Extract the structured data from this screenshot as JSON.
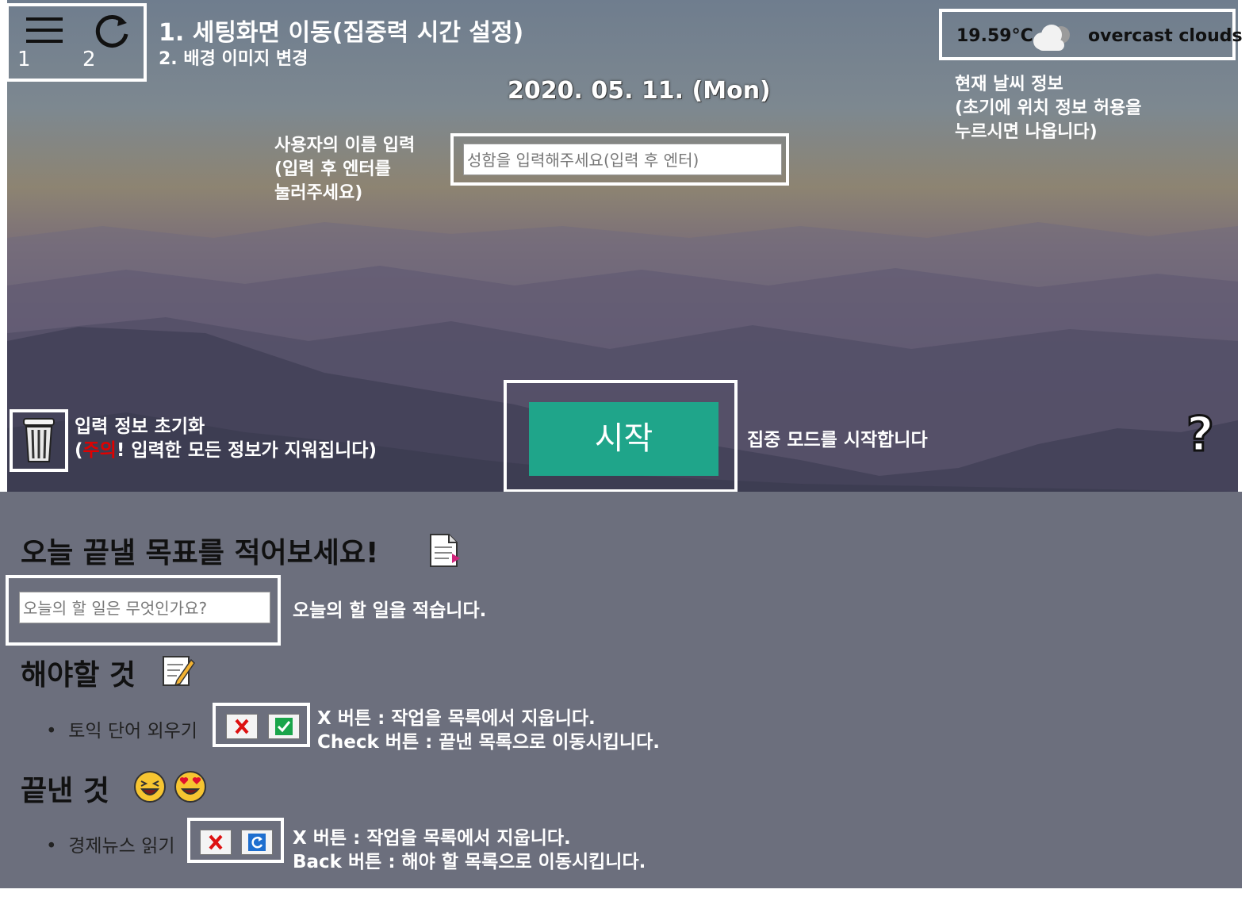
{
  "header": {
    "menu_number": "1",
    "refresh_number": "2",
    "note_line1": "1. 세팅화면 이동(집중력 시간 설정)",
    "note_line2": "2. 배경 이미지 변경"
  },
  "weather": {
    "temp": "19.59°C",
    "icon": "cloud-icon",
    "desc": "overcast clouds",
    "note_line1": "현재 날씨 정보",
    "note_line2": "(초기에 위치 정보 허용을",
    "note_line3": "누르시면 나옵니다)"
  },
  "date": "2020. 05. 11. (Mon)",
  "name_input": {
    "placeholder": "성함을 입력해주세요(입력 후 엔터)",
    "note_line1": "사용자의 이름 입력",
    "note_line2": "(입력 후 엔터를",
    "note_line3": "눌러주세요)"
  },
  "reset": {
    "icon": "trash-icon",
    "note_line1": "입력 정보 초기화",
    "note_paren_open": "(",
    "note_warning": "주의",
    "note_rest": "! 입력한 모든 정보가 지워집니다)"
  },
  "start": {
    "label": "시작",
    "note": "집중 모드를 시작합니다"
  },
  "help": {
    "label": "?"
  },
  "goal": {
    "title": "오늘 끝낼 목표를 적어보세요!",
    "title_icon": "document-icon",
    "placeholder": "오늘의 할 일은 무엇인가요?",
    "note": "오늘의 할 일을 적습니다."
  },
  "todo": {
    "title": "해야할 것",
    "title_icon": "memo-icon",
    "items": [
      {
        "text": "토익 단어 외우기"
      }
    ],
    "note_line1": "X 버튼 : 작업을 목록에서 지웁니다.",
    "note_line2": "Check 버튼 : 끝낸 목록으로 이동시킵니다."
  },
  "done": {
    "title": "끝낸 것",
    "title_icons": [
      "laughing-face-icon",
      "heart-eyes-face-icon"
    ],
    "items": [
      {
        "text": "경제뉴스 읽기"
      }
    ],
    "note_line1": "X 버튼 : 작업을 목록에서 지웁니다.",
    "note_line2": "Back 버튼 : 해야 할 목록으로 이동시킵니다."
  },
  "colors": {
    "start_button": "#1fa58a",
    "warning": "#e00000",
    "lower_bg": "#6c6f7d"
  }
}
